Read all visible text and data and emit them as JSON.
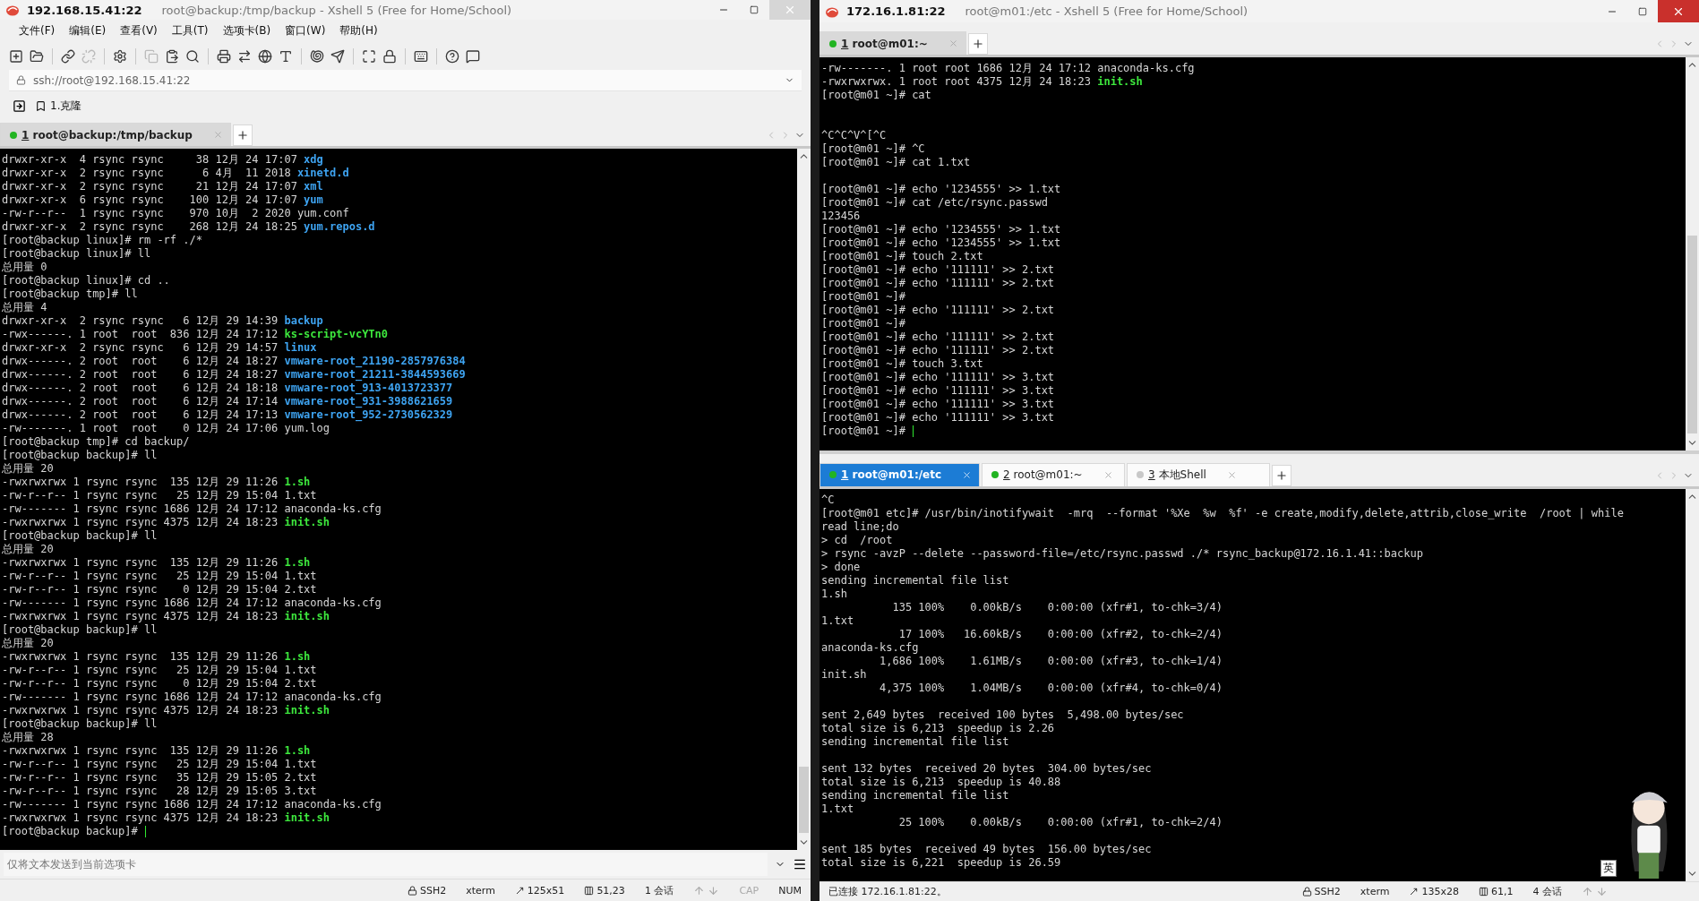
{
  "left_window": {
    "host": "192.168.15.41:22",
    "title": "root@backup:/tmp/backup - Xshell 5 (Free for Home/School)",
    "menu": [
      "文件(F)",
      "编辑(E)",
      "查看(V)",
      "工具(T)",
      "选项卡(B)",
      "窗口(W)",
      "帮助(H)"
    ],
    "address": "ssh://root@192.168.15.41:22",
    "bookmark": "1.克隆",
    "pane": {
      "focused": false,
      "tabs": [
        {
          "number": "1",
          "label": "root@backup:/tmp/backup",
          "selected": true,
          "color": "#22b422"
        }
      ],
      "cursor": true,
      "lines": [
        {
          "kind": "text",
          "text": "drwxr-xr-x  4 rsync rsync     38 12月 24 17:07 ",
          "file": {
            "text": "xdg",
            "kind": "dir"
          }
        },
        {
          "kind": "text",
          "text": "drwxr-xr-x  2 rsync rsync      6 4月  11 2018 ",
          "file": {
            "text": "xinetd.d",
            "kind": "dir"
          }
        },
        {
          "kind": "text",
          "text": "drwxr-xr-x  2 rsync rsync     21 12月 24 17:07 ",
          "file": {
            "text": "xml",
            "kind": "dir"
          }
        },
        {
          "kind": "text",
          "text": "drwxr-xr-x  6 rsync rsync    100 12月 24 17:07 ",
          "file": {
            "text": "yum",
            "kind": "dir"
          }
        },
        {
          "kind": "text",
          "text": "-rw-r--r--  1 rsync rsync    970 10月  2 2020 yum.conf"
        },
        {
          "kind": "text",
          "text": "drwxr-xr-x  2 rsync rsync    268 12月 24 18:25 ",
          "file": {
            "text": "yum.repos.d",
            "kind": "dir"
          }
        },
        {
          "kind": "text",
          "text": "[root@backup linux]# rm -rf ./*"
        },
        {
          "kind": "text",
          "text": "[root@backup linux]# ll"
        },
        {
          "kind": "text",
          "text": "总用量 0"
        },
        {
          "kind": "text",
          "text": "[root@backup linux]# cd .."
        },
        {
          "kind": "text",
          "text": "[root@backup tmp]# ll"
        },
        {
          "kind": "text",
          "text": "总用量 4"
        },
        {
          "kind": "text",
          "text": "drwxr-xr-x  2 rsync rsync   6 12月 29 14:39 ",
          "file": {
            "text": "backup",
            "kind": "dir"
          }
        },
        {
          "kind": "text",
          "text": "-rwx------. 1 root  root  836 12月 24 17:12 ",
          "file": {
            "text": "ks-script-vcYTn0",
            "kind": "exe"
          }
        },
        {
          "kind": "text",
          "text": "drwxr-xr-x  2 rsync rsync   6 12月 29 14:57 ",
          "file": {
            "text": "linux",
            "kind": "dir"
          }
        },
        {
          "kind": "text",
          "text": "drwx------. 2 root  root    6 12月 24 18:27 ",
          "file": {
            "text": "vmware-root_21190-2857976384",
            "kind": "dir"
          }
        },
        {
          "kind": "text",
          "text": "drwx------. 2 root  root    6 12月 24 18:27 ",
          "file": {
            "text": "vmware-root_21211-3844593669",
            "kind": "dir"
          }
        },
        {
          "kind": "text",
          "text": "drwx------. 2 root  root    6 12月 24 18:18 ",
          "file": {
            "text": "vmware-root_913-4013723377",
            "kind": "dir"
          }
        },
        {
          "kind": "text",
          "text": "drwx------. 2 root  root    6 12月 24 17:14 ",
          "file": {
            "text": "vmware-root_931-3988621659",
            "kind": "dir"
          }
        },
        {
          "kind": "text",
          "text": "drwx------. 2 root  root    6 12月 24 17:13 ",
          "file": {
            "text": "vmware-root_952-2730562329",
            "kind": "dir"
          }
        },
        {
          "kind": "text",
          "text": "-rw-------. 1 root  root    0 12月 24 17:06 yum.log"
        },
        {
          "kind": "text",
          "text": "[root@backup tmp]# cd backup/"
        },
        {
          "kind": "text",
          "text": "[root@backup backup]# ll"
        },
        {
          "kind": "text",
          "text": "总用量 20"
        },
        {
          "kind": "text",
          "text": "-rwxrwxrwx 1 rsync rsync  135 12月 29 11:26 ",
          "file": {
            "text": "1.sh",
            "kind": "exe"
          }
        },
        {
          "kind": "text",
          "text": "-rw-r--r-- 1 rsync rsync   25 12月 29 15:04 1.txt"
        },
        {
          "kind": "text",
          "text": "-rw------- 1 rsync rsync 1686 12月 24 17:12 anaconda-ks.cfg"
        },
        {
          "kind": "text",
          "text": "-rwxrwxrwx 1 rsync rsync 4375 12月 24 18:23 ",
          "file": {
            "text": "init.sh",
            "kind": "exe"
          }
        },
        {
          "kind": "text",
          "text": "[root@backup backup]# ll"
        },
        {
          "kind": "text",
          "text": "总用量 20"
        },
        {
          "kind": "text",
          "text": "-rwxrwxrwx 1 rsync rsync  135 12月 29 11:26 ",
          "file": {
            "text": "1.sh",
            "kind": "exe"
          }
        },
        {
          "kind": "text",
          "text": "-rw-r--r-- 1 rsync rsync   25 12月 29 15:04 1.txt"
        },
        {
          "kind": "text",
          "text": "-rw-r--r-- 1 rsync rsync    0 12月 29 15:04 2.txt"
        },
        {
          "kind": "text",
          "text": "-rw------- 1 rsync rsync 1686 12月 24 17:12 anaconda-ks.cfg"
        },
        {
          "kind": "text",
          "text": "-rwxrwxrwx 1 rsync rsync 4375 12月 24 18:23 ",
          "file": {
            "text": "init.sh",
            "kind": "exe"
          }
        },
        {
          "kind": "text",
          "text": "[root@backup backup]# ll"
        },
        {
          "kind": "text",
          "text": "总用量 20"
        },
        {
          "kind": "text",
          "text": "-rwxrwxrwx 1 rsync rsync  135 12月 29 11:26 ",
          "file": {
            "text": "1.sh",
            "kind": "exe"
          }
        },
        {
          "kind": "text",
          "text": "-rw-r--r-- 1 rsync rsync   25 12月 29 15:04 1.txt"
        },
        {
          "kind": "text",
          "text": "-rw-r--r-- 1 rsync rsync    0 12月 29 15:04 2.txt"
        },
        {
          "kind": "text",
          "text": "-rw------- 1 rsync rsync 1686 12月 24 17:12 anaconda-ks.cfg"
        },
        {
          "kind": "text",
          "text": "-rwxrwxrwx 1 rsync rsync 4375 12月 24 18:23 ",
          "file": {
            "text": "init.sh",
            "kind": "exe"
          }
        },
        {
          "kind": "text",
          "text": "[root@backup backup]# ll"
        },
        {
          "kind": "text",
          "text": "总用量 28"
        },
        {
          "kind": "text",
          "text": "-rwxrwxrwx 1 rsync rsync  135 12月 29 11:26 ",
          "file": {
            "text": "1.sh",
            "kind": "exe"
          }
        },
        {
          "kind": "text",
          "text": "-rw-r--r-- 1 rsync rsync   25 12月 29 15:04 1.txt"
        },
        {
          "kind": "text",
          "text": "-rw-r--r-- 1 rsync rsync   35 12月 29 15:05 2.txt"
        },
        {
          "kind": "text",
          "text": "-rw-r--r-- 1 rsync rsync   28 12月 29 15:05 3.txt"
        },
        {
          "kind": "text",
          "text": "-rw------- 1 rsync rsync 1686 12月 24 17:12 anaconda-ks.cfg"
        },
        {
          "kind": "text",
          "text": "-rwxrwxrwx 1 rsync rsync 4375 12月 24 18:23 ",
          "file": {
            "text": "init.sh",
            "kind": "exe"
          }
        },
        {
          "kind": "text",
          "text": "[root@backup backup]# "
        }
      ]
    },
    "compose_placeholder": "仅将文本发送到当前选项卡",
    "status": [
      {
        "kind": "ssh",
        "text": "SSH2"
      },
      {
        "kind": "plain",
        "text": "xterm"
      },
      {
        "kind": "size",
        "text": "125x51"
      },
      {
        "kind": "position",
        "text": "51,23"
      },
      {
        "kind": "plain",
        "text": "1 会话"
      },
      {
        "kind": "arrows"
      },
      {
        "kind": "key",
        "text": "CAP",
        "on": false
      },
      {
        "kind": "key",
        "text": "NUM",
        "on": true
      }
    ]
  },
  "right_window": {
    "host": "172.16.1.81:22",
    "title": "root@m01:/etc - Xshell 5 (Free for Home/School)",
    "top_pane": {
      "focused": false,
      "tabs": [
        {
          "number": "1",
          "label": "root@m01:~",
          "selected": true,
          "color": "#22b422"
        }
      ],
      "cursor": true,
      "lines": [
        {
          "kind": "text",
          "text": "-rw-------. 1 root root 1686 12月 24 17:12 anaconda-ks.cfg"
        },
        {
          "kind": "text",
          "text": "-rwxrwxrwx. 1 root root 4375 12月 24 18:23 ",
          "file": {
            "text": "init.sh",
            "kind": "exe"
          }
        },
        {
          "kind": "text",
          "text": "[root@m01 ~]# cat"
        },
        {
          "kind": "blank"
        },
        {
          "kind": "blank"
        },
        {
          "kind": "text",
          "text": "^C^C^V^[^C"
        },
        {
          "kind": "text",
          "text": "[root@m01 ~]# ^C"
        },
        {
          "kind": "text",
          "text": "[root@m01 ~]# cat 1.txt"
        },
        {
          "kind": "blank"
        },
        {
          "kind": "text",
          "text": "[root@m01 ~]# echo '1234555' >> 1.txt"
        },
        {
          "kind": "text",
          "text": "[root@m01 ~]# cat /etc/rsync.passwd"
        },
        {
          "kind": "text",
          "text": "123456"
        },
        {
          "kind": "text",
          "text": "[root@m01 ~]# echo '1234555' >> 1.txt"
        },
        {
          "kind": "text",
          "text": "[root@m01 ~]# echo '1234555' >> 1.txt"
        },
        {
          "kind": "text",
          "text": "[root@m01 ~]# touch 2.txt"
        },
        {
          "kind": "text",
          "text": "[root@m01 ~]# echo '111111' >> 2.txt"
        },
        {
          "kind": "text",
          "text": "[root@m01 ~]# echo '111111' >> 2.txt"
        },
        {
          "kind": "text",
          "text": "[root@m01 ~]#"
        },
        {
          "kind": "text",
          "text": "[root@m01 ~]# echo '111111' >> 2.txt"
        },
        {
          "kind": "text",
          "text": "[root@m01 ~]#"
        },
        {
          "kind": "text",
          "text": "[root@m01 ~]# echo '111111' >> 2.txt"
        },
        {
          "kind": "text",
          "text": "[root@m01 ~]# echo '111111' >> 2.txt"
        },
        {
          "kind": "text",
          "text": "[root@m01 ~]# touch 3.txt"
        },
        {
          "kind": "text",
          "text": "[root@m01 ~]# echo '111111' >> 3.txt"
        },
        {
          "kind": "text",
          "text": "[root@m01 ~]# echo '111111' >> 3.txt"
        },
        {
          "kind": "text",
          "text": "[root@m01 ~]# echo '111111' >> 3.txt"
        },
        {
          "kind": "text",
          "text": "[root@m01 ~]# echo '111111' >> 3.txt"
        },
        {
          "kind": "text",
          "text": "[root@m01 ~]# "
        }
      ]
    },
    "bottom_pane": {
      "focused": true,
      "tabs": [
        {
          "number": "1",
          "label": "root@m01:/etc",
          "selected": true,
          "color": "#22b422"
        },
        {
          "number": "2",
          "label": "root@m01:~",
          "selected": false,
          "color": "#22b422"
        },
        {
          "number": "3",
          "label": "本地Shell",
          "selected": false,
          "color": "#c8c8c8"
        }
      ],
      "lines": [
        {
          "kind": "text",
          "text": "^C"
        },
        {
          "kind": "text",
          "text": "[root@m01 etc]# /usr/bin/inotifywait  -mrq  --format '%Xe  %w  %f' -e create,modify,delete,attrib,close_write  /root | while"
        },
        {
          "kind": "text",
          "text": "read line;do"
        },
        {
          "kind": "text",
          "text": "> cd  /root"
        },
        {
          "kind": "text",
          "text": "> rsync -avzP --delete --password-file=/etc/rsync.passwd ./* rsync_backup@172.16.1.41::backup"
        },
        {
          "kind": "text",
          "text": "> done"
        },
        {
          "kind": "text",
          "text": "sending incremental file list"
        },
        {
          "kind": "text",
          "text": "1.sh"
        },
        {
          "kind": "text",
          "text": "           135 100%    0.00kB/s    0:00:00 (xfr#1, to-chk=3/4)"
        },
        {
          "kind": "text",
          "text": "1.txt"
        },
        {
          "kind": "text",
          "text": "            17 100%   16.60kB/s    0:00:00 (xfr#2, to-chk=2/4)"
        },
        {
          "kind": "text",
          "text": "anaconda-ks.cfg"
        },
        {
          "kind": "text",
          "text": "         1,686 100%    1.61MB/s    0:00:00 (xfr#3, to-chk=1/4)"
        },
        {
          "kind": "text",
          "text": "init.sh"
        },
        {
          "kind": "text",
          "text": "         4,375 100%    1.04MB/s    0:00:00 (xfr#4, to-chk=0/4)"
        },
        {
          "kind": "blank"
        },
        {
          "kind": "text",
          "text": "sent 2,649 bytes  received 100 bytes  5,498.00 bytes/sec"
        },
        {
          "kind": "text",
          "text": "total size is 6,213  speedup is 2.26"
        },
        {
          "kind": "text",
          "text": "sending incremental file list"
        },
        {
          "kind": "blank"
        },
        {
          "kind": "text",
          "text": "sent 132 bytes  received 20 bytes  304.00 bytes/sec"
        },
        {
          "kind": "text",
          "text": "total size is 6,213  speedup is 40.88"
        },
        {
          "kind": "text",
          "text": "sending incremental file list"
        },
        {
          "kind": "text",
          "text": "1.txt"
        },
        {
          "kind": "text",
          "text": "            25 100%    0.00kB/s    0:00:00 (xfr#1, to-chk=2/4)"
        },
        {
          "kind": "blank"
        },
        {
          "kind": "text",
          "text": "sent 185 bytes  received 49 bytes  156.00 bytes/sec"
        },
        {
          "kind": "text",
          "text": "total size is 6,221  speedup is 26.59"
        }
      ]
    },
    "status_message": "已连接 172.16.1.81:22。",
    "status": [
      {
        "kind": "ssh",
        "text": "SSH2"
      },
      {
        "kind": "plain",
        "text": "xterm"
      },
      {
        "kind": "size",
        "text": "135x28"
      },
      {
        "kind": "position",
        "text": "61,1"
      },
      {
        "kind": "plain",
        "text": "4 会话"
      },
      {
        "kind": "arrows"
      }
    ],
    "ime_badge": "英"
  }
}
